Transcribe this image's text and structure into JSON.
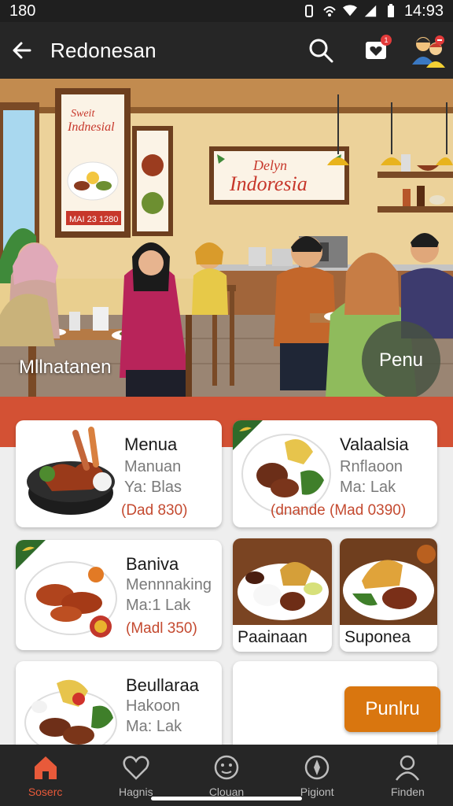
{
  "status_bar": {
    "left_text": "180",
    "time": "14:93"
  },
  "app_bar": {
    "title": "Redonesan",
    "notification_count": "1"
  },
  "hero": {
    "caption_left": "Mllnatanen",
    "cta_label": "Penu",
    "sign_banner": {
      "line1": "Delyn",
      "line2": "Indoresia"
    },
    "poster": {
      "line1": "Sweit",
      "line2": "Indnesial",
      "footer": "MAI 23 1280"
    }
  },
  "cards": [
    {
      "title": "Menua",
      "line1": "Manuan",
      "line2": "Ya: Blas",
      "price": "(Dad 830)"
    },
    {
      "title": "Valaalsia",
      "line1": "Rnflaoon",
      "line2": "Ma: Lak",
      "price": "(dnande  (Mad 0390)"
    },
    {
      "title": "Baniva",
      "line1": "Mennnaking",
      "line2": "Ma:1 Lak",
      "price": "(Madl 350)"
    },
    {
      "title": "Beullaraa",
      "line1": "Hakoon",
      "line2": "Ma: Lak"
    }
  ],
  "photo_cards": [
    {
      "caption": "Paainaan"
    },
    {
      "caption": "Suponea"
    }
  ],
  "order_button": {
    "label": "Punlru"
  },
  "bottom_nav": [
    {
      "label": "Soserc",
      "icon": "home-icon"
    },
    {
      "label": "Hagnis",
      "icon": "heart-icon"
    },
    {
      "label": "Clouan",
      "icon": "face-icon"
    },
    {
      "label": "Pigiont",
      "icon": "compass-icon"
    },
    {
      "label": "Finden",
      "icon": "user-icon"
    }
  ],
  "colors": {
    "accent": "#d35134",
    "button": "#d9760f",
    "bar": "#262626"
  }
}
